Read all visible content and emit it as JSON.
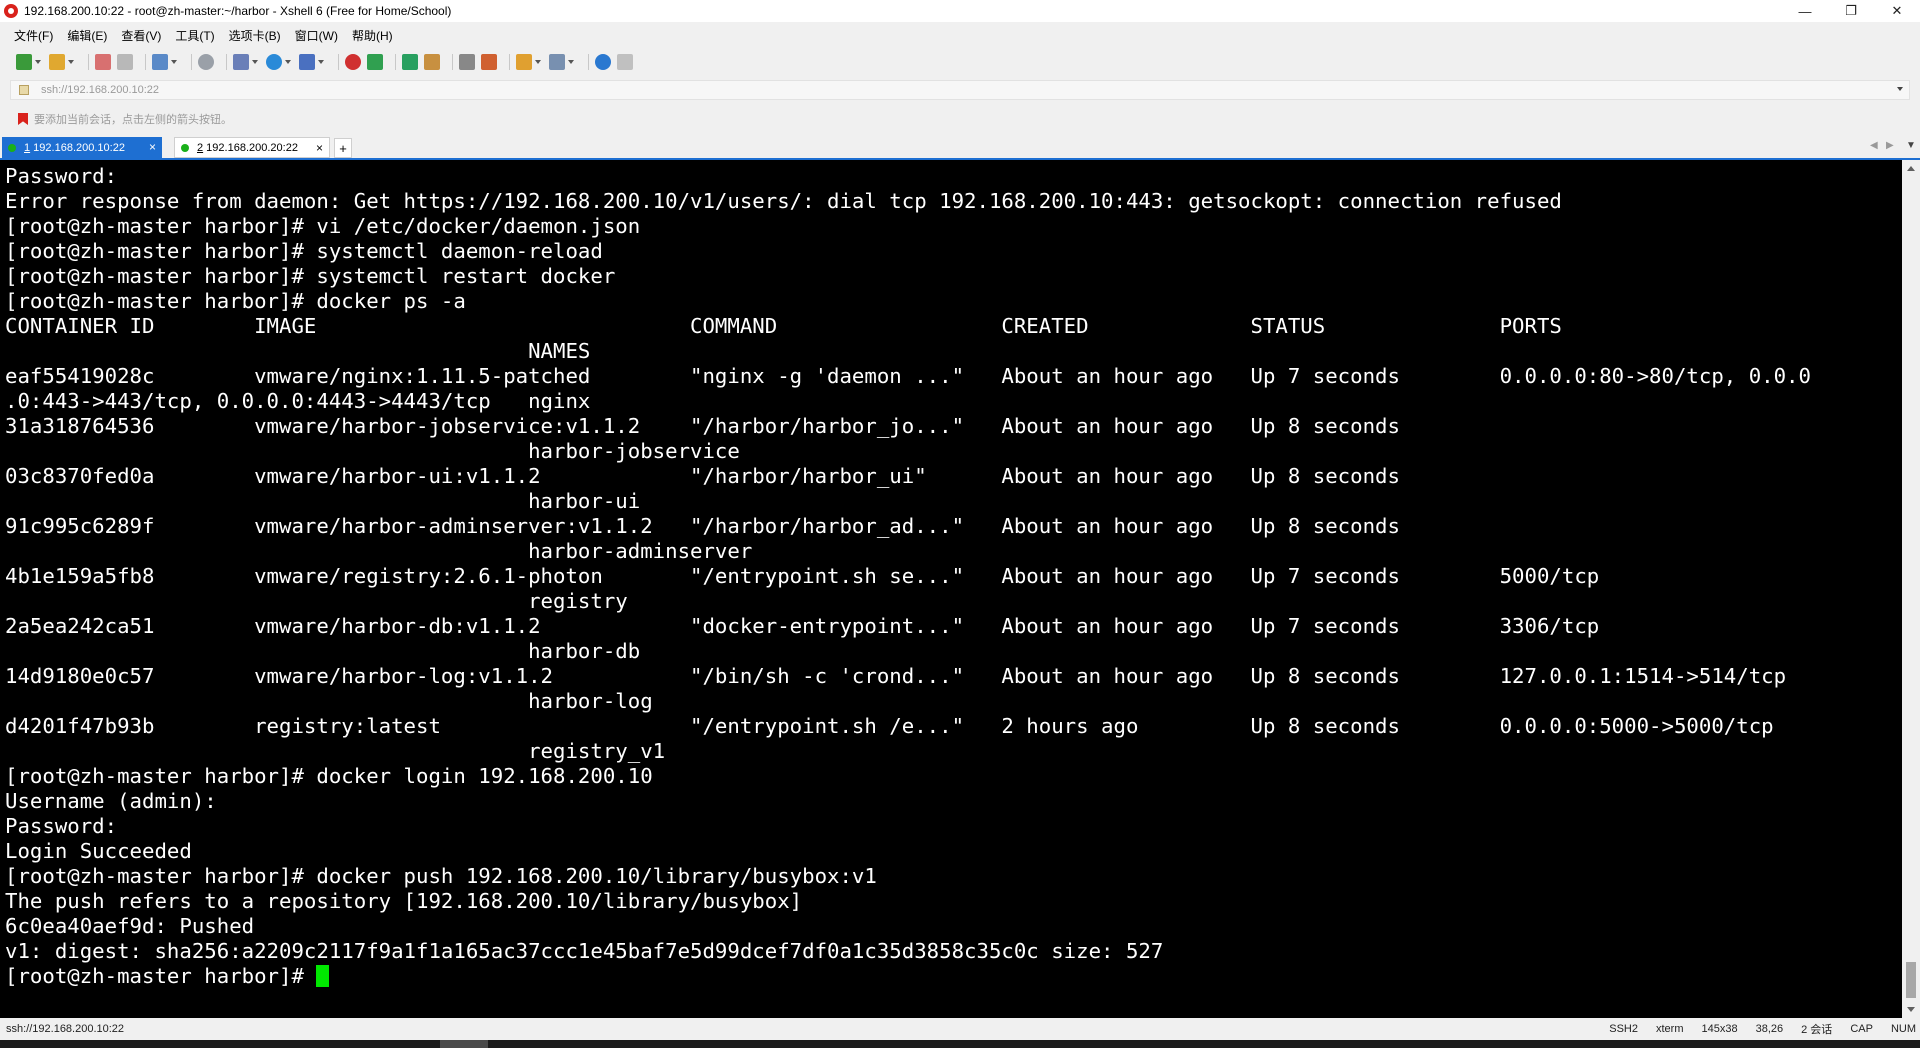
{
  "window": {
    "title": "192.168.200.10:22 - root@zh-master:~/harbor - Xshell 6 (Free for Home/School)",
    "minimize_glyph": "—",
    "restore_glyph": "❐",
    "close_glyph": "✕"
  },
  "menu": [
    "文件(F)",
    "编辑(E)",
    "查看(V)",
    "工具(T)",
    "选项卡(B)",
    "窗口(W)",
    "帮助(H)"
  ],
  "address": {
    "value": "ssh://192.168.200.10:22"
  },
  "hint": {
    "text": "要添加当前会话，点击左侧的箭头按钮。"
  },
  "tabs": [
    {
      "number": "1",
      "label": " 192.168.200.10:22",
      "close": "×",
      "active": true,
      "status": "connected"
    },
    {
      "number": "2",
      "label": " 192.168.200.20:22",
      "close": "×",
      "active": false,
      "status": "connected"
    }
  ],
  "tab_add": "+",
  "terminal": {
    "lines": [
      "Password:",
      "Error response from daemon: Get https://192.168.200.10/v1/users/: dial tcp 192.168.200.10:443: getsockopt: connection refused",
      "[root@zh-master harbor]# vi /etc/docker/daemon.json",
      "[root@zh-master harbor]# systemctl daemon-reload",
      "[root@zh-master harbor]# systemctl restart docker",
      "[root@zh-master harbor]# docker ps -a",
      "CONTAINER ID        IMAGE                              COMMAND                  CREATED             STATUS              PORTS",
      "                                          NAMES",
      "eaf55419028c        vmware/nginx:1.11.5-patched        \"nginx -g 'daemon ...\"   About an hour ago   Up 7 seconds        0.0.0.0:80->80/tcp, 0.0.0",
      ".0:443->443/tcp, 0.0.0.0:4443->4443/tcp   nginx",
      "31a318764536        vmware/harbor-jobservice:v1.1.2    \"/harbor/harbor_jo...\"   About an hour ago   Up 8 seconds",
      "                                          harbor-jobservice",
      "03c8370fed0a        vmware/harbor-ui:v1.1.2            \"/harbor/harbor_ui\"      About an hour ago   Up 8 seconds",
      "                                          harbor-ui",
      "91c995c6289f        vmware/harbor-adminserver:v1.1.2   \"/harbor/harbor_ad...\"   About an hour ago   Up 8 seconds",
      "                                          harbor-adminserver",
      "4b1e159a5fb8        vmware/registry:2.6.1-photon       \"/entrypoint.sh se...\"   About an hour ago   Up 7 seconds        5000/tcp",
      "                                          registry",
      "2a5ea242ca51        vmware/harbor-db:v1.1.2            \"docker-entrypoint...\"   About an hour ago   Up 7 seconds        3306/tcp",
      "                                          harbor-db",
      "14d9180e0c57        vmware/harbor-log:v1.1.2           \"/bin/sh -c 'crond...\"   About an hour ago   Up 8 seconds        127.0.0.1:1514->514/tcp",
      "                                          harbor-log",
      "d4201f47b93b        registry:latest                    \"/entrypoint.sh /e...\"   2 hours ago         Up 8 seconds        0.0.0.0:5000->5000/tcp",
      "                                          registry_v1",
      "[root@zh-master harbor]# docker login 192.168.200.10",
      "Username (admin):",
      "Password:",
      "Login Succeeded",
      "[root@zh-master harbor]# docker push 192.168.200.10/library/busybox:v1",
      "The push refers to a repository [192.168.200.10/library/busybox]",
      "6c0ea40aef9d: Pushed",
      "v1: digest: sha256:a2209c2117f9a1f1a165ac37ccc1e45baf7e5d99dcef7df0a1c35d3858c35c0c size: 527"
    ],
    "prompt": "[root@zh-master harbor]# "
  },
  "statusbar": {
    "address": "ssh://192.168.200.10:22",
    "protocol": "SSH2",
    "terminal_type": "xterm",
    "size": "145x38",
    "cursor_pos": "38,26",
    "sessions": "2 会话",
    "caps": "CAP",
    "num": "NUM"
  },
  "colors": {
    "tab_active": "#1e6fd2",
    "terminal_bg": "#000000",
    "terminal_fg": "#ffffff",
    "cursor": "#00e800",
    "app_icon": "#d9221c"
  }
}
